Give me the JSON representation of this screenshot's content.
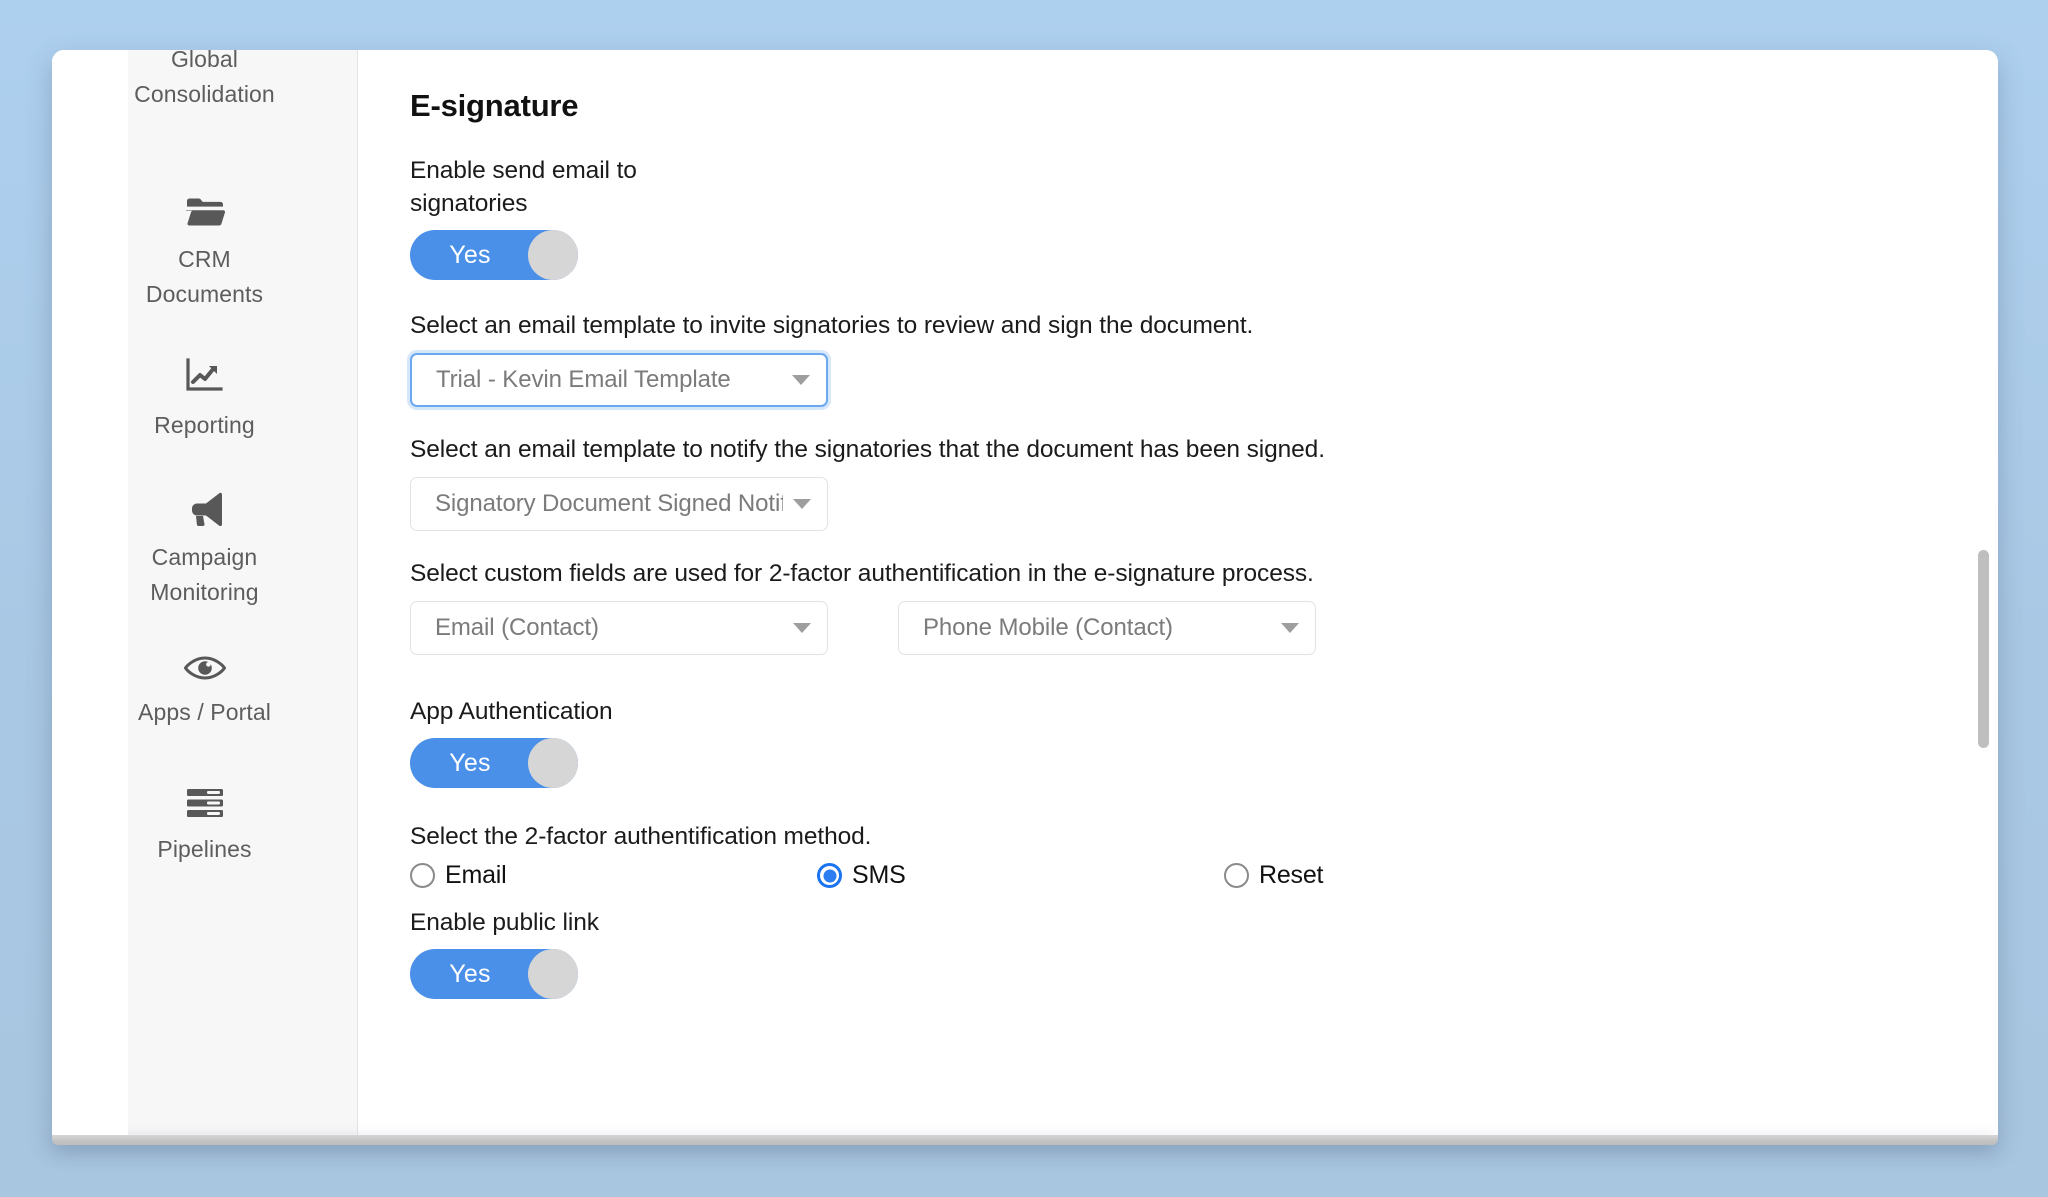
{
  "sidebar": {
    "items": [
      {
        "label": "Global\nConsolidation",
        "icon": "none",
        "name": "global-consolidation"
      },
      {
        "label": "CRM\nDocuments",
        "icon": "folder-icon",
        "name": "crm-documents"
      },
      {
        "label": "Reporting",
        "icon": "chart-line-icon",
        "name": "reporting"
      },
      {
        "label": "Campaign\nMonitoring",
        "icon": "megaphone-icon",
        "name": "campaign-monitoring"
      },
      {
        "label": "Apps / Portal",
        "icon": "eye-icon",
        "name": "apps-portal"
      },
      {
        "label": "Pipelines",
        "icon": "pipelines-icon",
        "name": "pipelines"
      }
    ]
  },
  "main": {
    "title": "E-signature",
    "enable_send_email": {
      "label": "Enable send email to signatories",
      "toggle_value": "Yes",
      "enabled": true
    },
    "invite_template": {
      "label": "Select an email template to invite signatories to review and sign the document.",
      "value": "Trial - Kevin Email Template",
      "focused": true
    },
    "signed_template": {
      "label": "Select an email template to notify the signatories that the document has been signed.",
      "value": "Signatory Document Signed Notifi...",
      "focused": false
    },
    "custom_fields": {
      "label": "Select custom fields are used for 2-factor authentification in the e-signature process.",
      "field_1": "Email (Contact)",
      "field_2": "Phone Mobile (Contact)"
    },
    "app_authentication": {
      "label": "App Authentication",
      "toggle_value": "Yes",
      "enabled": true
    },
    "two_factor_method": {
      "label": "Select the 2-factor authentification method.",
      "options": [
        {
          "label": "Email",
          "selected": false
        },
        {
          "label": "SMS",
          "selected": true
        },
        {
          "label": "Reset",
          "selected": false
        }
      ]
    },
    "enable_public_link": {
      "label": "Enable public link",
      "toggle_value": "Yes",
      "enabled": true
    }
  },
  "colors": {
    "accent_blue": "#4a90e8",
    "radio_blue": "#2b7df0",
    "focus_border": "#6aa8ef",
    "desktop_bg": "#aed0ef"
  }
}
